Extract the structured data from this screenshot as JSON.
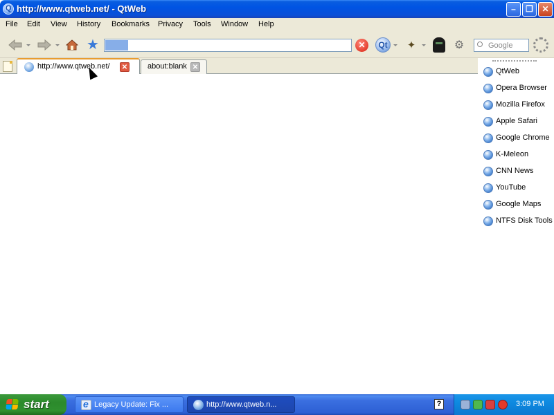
{
  "window": {
    "title": "http://www.qtweb.net/ - QtWeb",
    "min_label": "–",
    "max_label": "❐",
    "close_label": "✕"
  },
  "menu": [
    "File",
    "Edit",
    "View",
    "History",
    "Bookmarks",
    "Privacy",
    "Tools",
    "Window",
    "Help"
  ],
  "toolbar": {
    "search_placeholder": "Google",
    "stop_glyph": "✕",
    "qt_glyph": "Qt",
    "wand_glyph": "✦",
    "gears_glyph": "⚙",
    "star_glyph": "★"
  },
  "tabs": [
    {
      "label": "http://www.qtweb.net/",
      "active": true
    },
    {
      "label": "about:blank",
      "active": false
    }
  ],
  "tab_close_glyph": "✕",
  "bookmarks": [
    "QtWeb",
    "Opera Browser",
    "Mozilla Firefox",
    "Apple Safari",
    "Google Chrome",
    "K-Meleon",
    "CNN News",
    "YouTube",
    "Google Maps",
    "NTFS Disk Tools"
  ],
  "taskbar": {
    "start_label": "start",
    "tasks": [
      {
        "label": "Legacy Update: Fix ..."
      },
      {
        "label": "http://www.qtweb.n..."
      }
    ],
    "help_glyph": "?",
    "clock": "3:09 PM"
  },
  "colors": {
    "title_bar": "#0054e3",
    "start_button": "#2b8a2b",
    "tray": "#0d8ae0",
    "active_tab_accent": "#e89c30"
  }
}
